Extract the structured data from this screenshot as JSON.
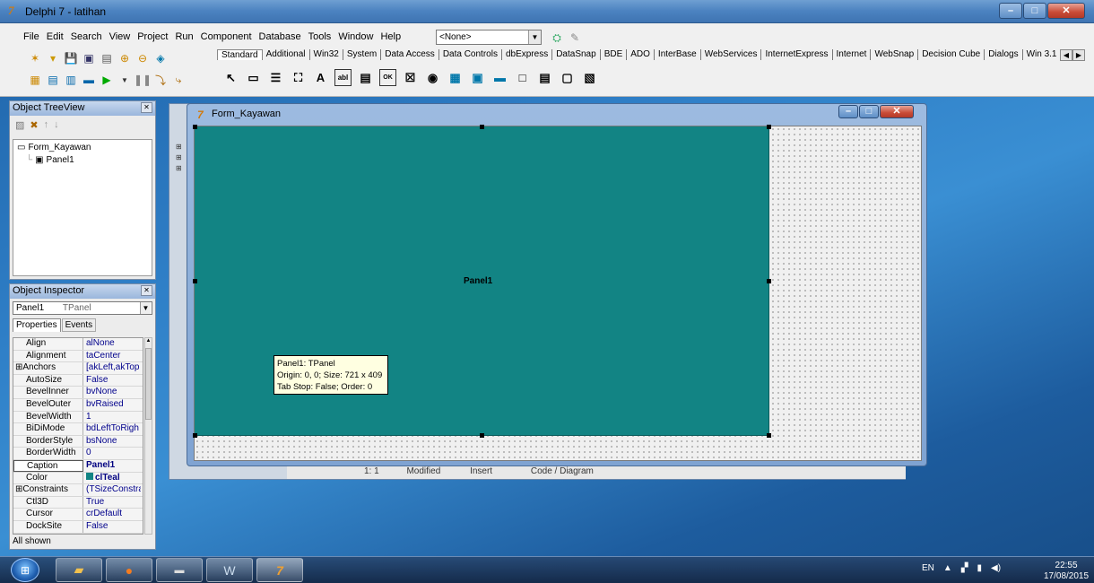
{
  "app": {
    "title": "Delphi 7 - latihan",
    "icon_glyph": "7",
    "window_buttons": [
      "–",
      "□",
      "✕"
    ]
  },
  "menu": [
    "File",
    "Edit",
    "Search",
    "View",
    "Project",
    "Run",
    "Component",
    "Database",
    "Tools",
    "Window",
    "Help"
  ],
  "desktop_combo": {
    "value": "<None>"
  },
  "palette_tabs": [
    "Standard",
    "Additional",
    "Win32",
    "System",
    "Data Access",
    "Data Controls",
    "dbExpress",
    "DataSnap",
    "BDE",
    "ADO",
    "InterBase",
    "WebServices",
    "InternetExpress",
    "Internet",
    "WebSnap",
    "Decision Cube",
    "Dialogs",
    "Win 3.1"
  ],
  "palette_icons": [
    "↖",
    "▭",
    "☰",
    "⛶",
    "A",
    "abl",
    "▤",
    "OK",
    "☒",
    "◉",
    "▦",
    "▣",
    "▬",
    "□",
    "▤",
    "▢",
    "▧"
  ],
  "tree_view": {
    "title": "Object TreeView",
    "nodes": [
      "Form_Kayawan",
      "Panel1"
    ]
  },
  "object_inspector": {
    "title": "Object Inspector",
    "selected_object": "Panel1",
    "selected_type": "TPanel",
    "tabs": [
      "Properties",
      "Events"
    ],
    "properties": [
      {
        "name": "Align",
        "value": "alNone"
      },
      {
        "name": "Alignment",
        "value": "taCenter"
      },
      {
        "name": "⊞Anchors",
        "value": "[akLeft,akTop"
      },
      {
        "name": "AutoSize",
        "value": "False"
      },
      {
        "name": "BevelInner",
        "value": "bvNone"
      },
      {
        "name": "BevelOuter",
        "value": "bvRaised"
      },
      {
        "name": "BevelWidth",
        "value": "1"
      },
      {
        "name": "BiDiMode",
        "value": "bdLeftToRigh"
      },
      {
        "name": "BorderStyle",
        "value": "bsNone"
      },
      {
        "name": "BorderWidth",
        "value": "0"
      },
      {
        "name": "Caption",
        "value": "Panel1"
      },
      {
        "name": "Color",
        "value": "clTeal"
      },
      {
        "name": "⊞Constraints",
        "value": "(TSizeConstra"
      },
      {
        "name": "Ctl3D",
        "value": "True"
      },
      {
        "name": "Cursor",
        "value": "crDefault"
      },
      {
        "name": "DockSite",
        "value": "False"
      }
    ],
    "footer": "All shown"
  },
  "form": {
    "title": "Form_Kayawan",
    "panel_caption": "Panel1",
    "tooltip": [
      "Panel1: TPanel",
      "Origin: 0, 0; Size: 721 x 409",
      "Tab Stop: False; Order: 0"
    ]
  },
  "editor_status": {
    "pos": "1:  1",
    "modified": "Modified",
    "insert": "Insert",
    "tabs": "Code / Diagram"
  },
  "taskbar": {
    "tray_lang": "EN",
    "time": "22:55",
    "date": "17/08/2015"
  },
  "colors": {
    "panel": "#128484",
    "titlebar": "#4b82c0"
  }
}
